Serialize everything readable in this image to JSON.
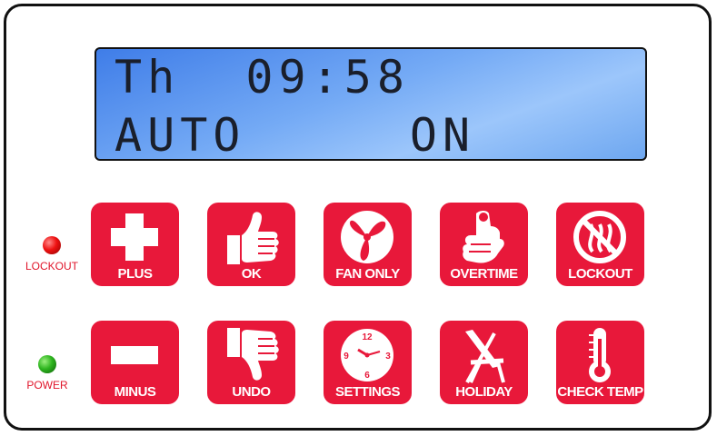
{
  "display": {
    "line1": "Th  09:58",
    "line2": "AUTO     ON"
  },
  "indicators": {
    "lockout_label": "LOCKOUT",
    "power_label": "POWER"
  },
  "buttons": {
    "plus": "PLUS",
    "ok": "OK",
    "fan_only": "FAN ONLY",
    "overtime": "OVERTIME",
    "lockout": "LOCKOUT",
    "minus": "MINUS",
    "undo": "UNDO",
    "settings": "SETTINGS",
    "holiday": "HOLIDAY",
    "check_temp": "CHECK TEMP"
  },
  "clock_numbers": {
    "n12": "12",
    "n3": "3",
    "n6": "6",
    "n9": "9"
  },
  "colors": {
    "button_red": "#e8183a",
    "lcd_blue": "#74aaf5",
    "lockout_led": "#e11111",
    "power_led": "#2eb51f"
  }
}
